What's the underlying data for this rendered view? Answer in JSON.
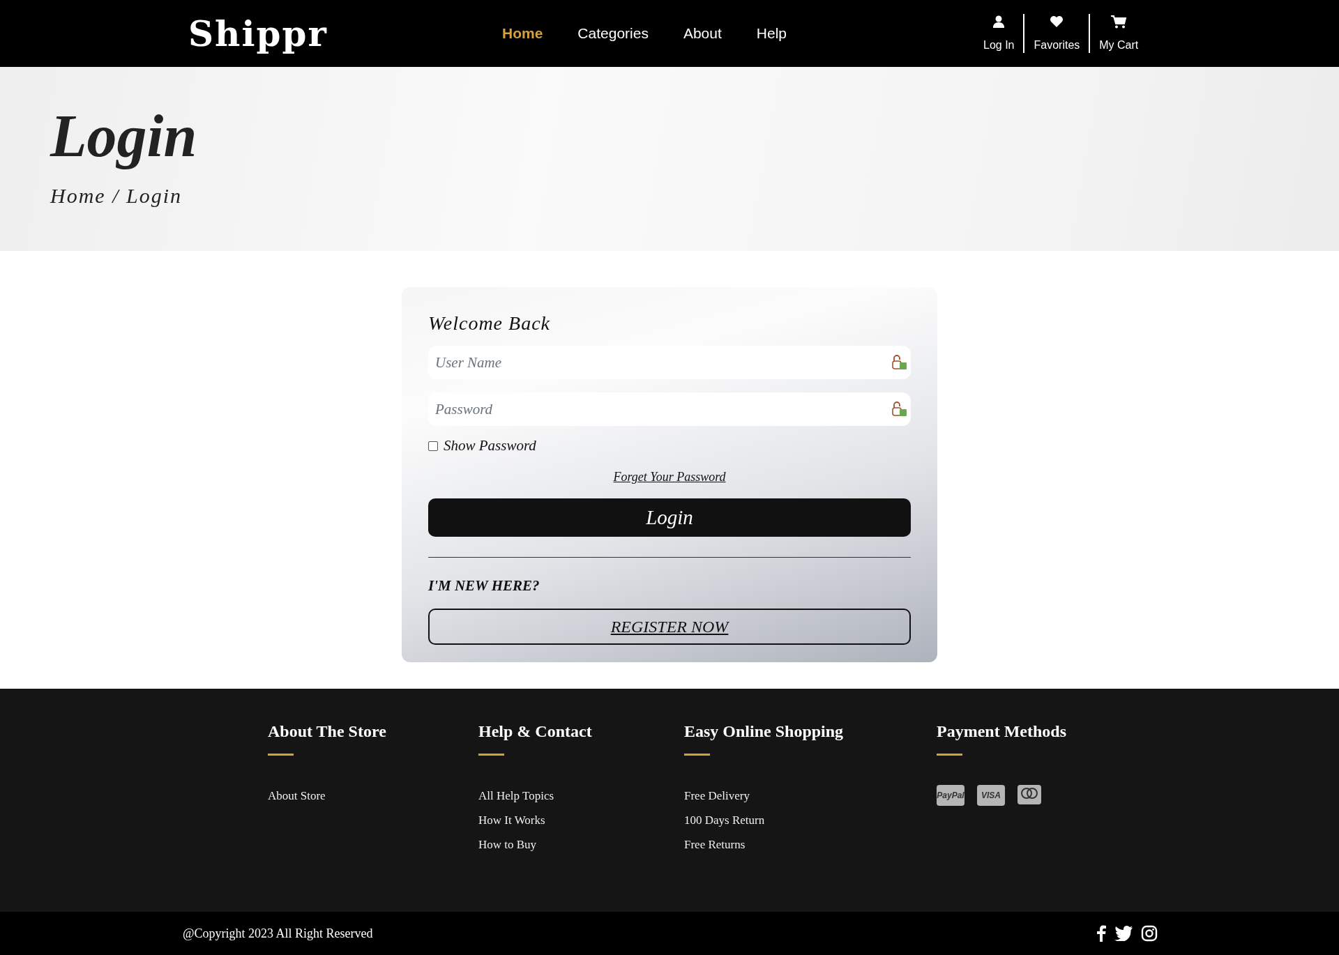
{
  "header": {
    "logo": "Shippr",
    "nav": [
      {
        "label": "Home",
        "selected": true
      },
      {
        "label": "Categories",
        "selected": false
      },
      {
        "label": "About",
        "selected": false
      },
      {
        "label": "Help",
        "selected": false
      }
    ],
    "actions": [
      {
        "kind": "user",
        "label": "Log In"
      },
      {
        "kind": "heart",
        "label": "Favorites"
      },
      {
        "kind": "cart",
        "label": "My Cart"
      }
    ]
  },
  "hero": {
    "title": "Login",
    "breadcrumb": "Home / Login"
  },
  "login_form": {
    "title": "Welcome Back",
    "fields": [
      {
        "placeholder": "User Name"
      },
      {
        "placeholder": "Password"
      }
    ],
    "show_password": {
      "label": "Show Password",
      "checked": false
    },
    "forgot_link": "Forget Your Password",
    "submit": "Login",
    "new_here": "I'M NEW HERE?",
    "register": "REGISTER NOW"
  },
  "footer": {
    "columns": [
      {
        "title": "About The Store",
        "links": [
          "About Store"
        ]
      },
      {
        "title": "Help & Contact",
        "links": [
          "All Help Topics",
          "How It Works",
          "How to Buy"
        ]
      },
      {
        "title": "Easy Online Shopping",
        "links": [
          "Free Delivery",
          "100 Days Return",
          "Free Returns"
        ]
      }
    ],
    "payment": {
      "title": "Payment Methods",
      "methods": [
        {
          "kind": "text",
          "label": "PayPal"
        },
        {
          "kind": "text",
          "label": "VISA"
        },
        {
          "kind": "circles"
        }
      ]
    },
    "copyright": "@Copyright 2023 All Right Reserved",
    "social": [
      {
        "kind": "facebook"
      },
      {
        "kind": "twitter"
      },
      {
        "kind": "instagram"
      }
    ]
  }
}
